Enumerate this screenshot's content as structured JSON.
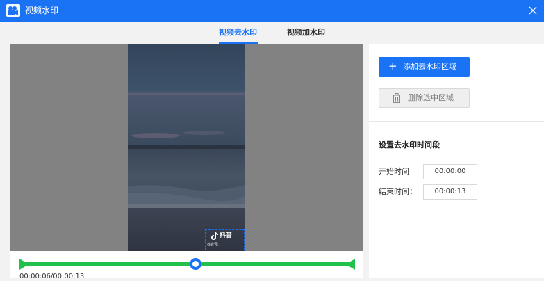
{
  "titlebar": {
    "icon": "video-camera-icon",
    "title": "视频水印",
    "close_icon": "close-icon"
  },
  "tabs": [
    {
      "label": "视频去水印",
      "active": true
    },
    {
      "label": "视频加水印",
      "active": false
    }
  ],
  "preview": {
    "watermark_logo": "抖音",
    "watermark_logo_icon": "tiktok-note-icon",
    "watermark_id": "抖音号:"
  },
  "timeline": {
    "timecode": "00:00:06/00:00:13",
    "playhead_fraction": 0.46,
    "track_color": "#21c14a"
  },
  "actions": {
    "add_region_label": "添加去水印区域",
    "add_icon": "plus-icon",
    "delete_region_label": "删除选中区域",
    "delete_icon": "trash-icon"
  },
  "time_settings": {
    "title": "设置去水印时间段",
    "start_label": "开始时间",
    "start_value": "00:00:00",
    "end_label": "结束时间：",
    "end_value": "00:00:13"
  },
  "colors": {
    "accent": "#1a73f5",
    "progress": "#21c14a"
  }
}
